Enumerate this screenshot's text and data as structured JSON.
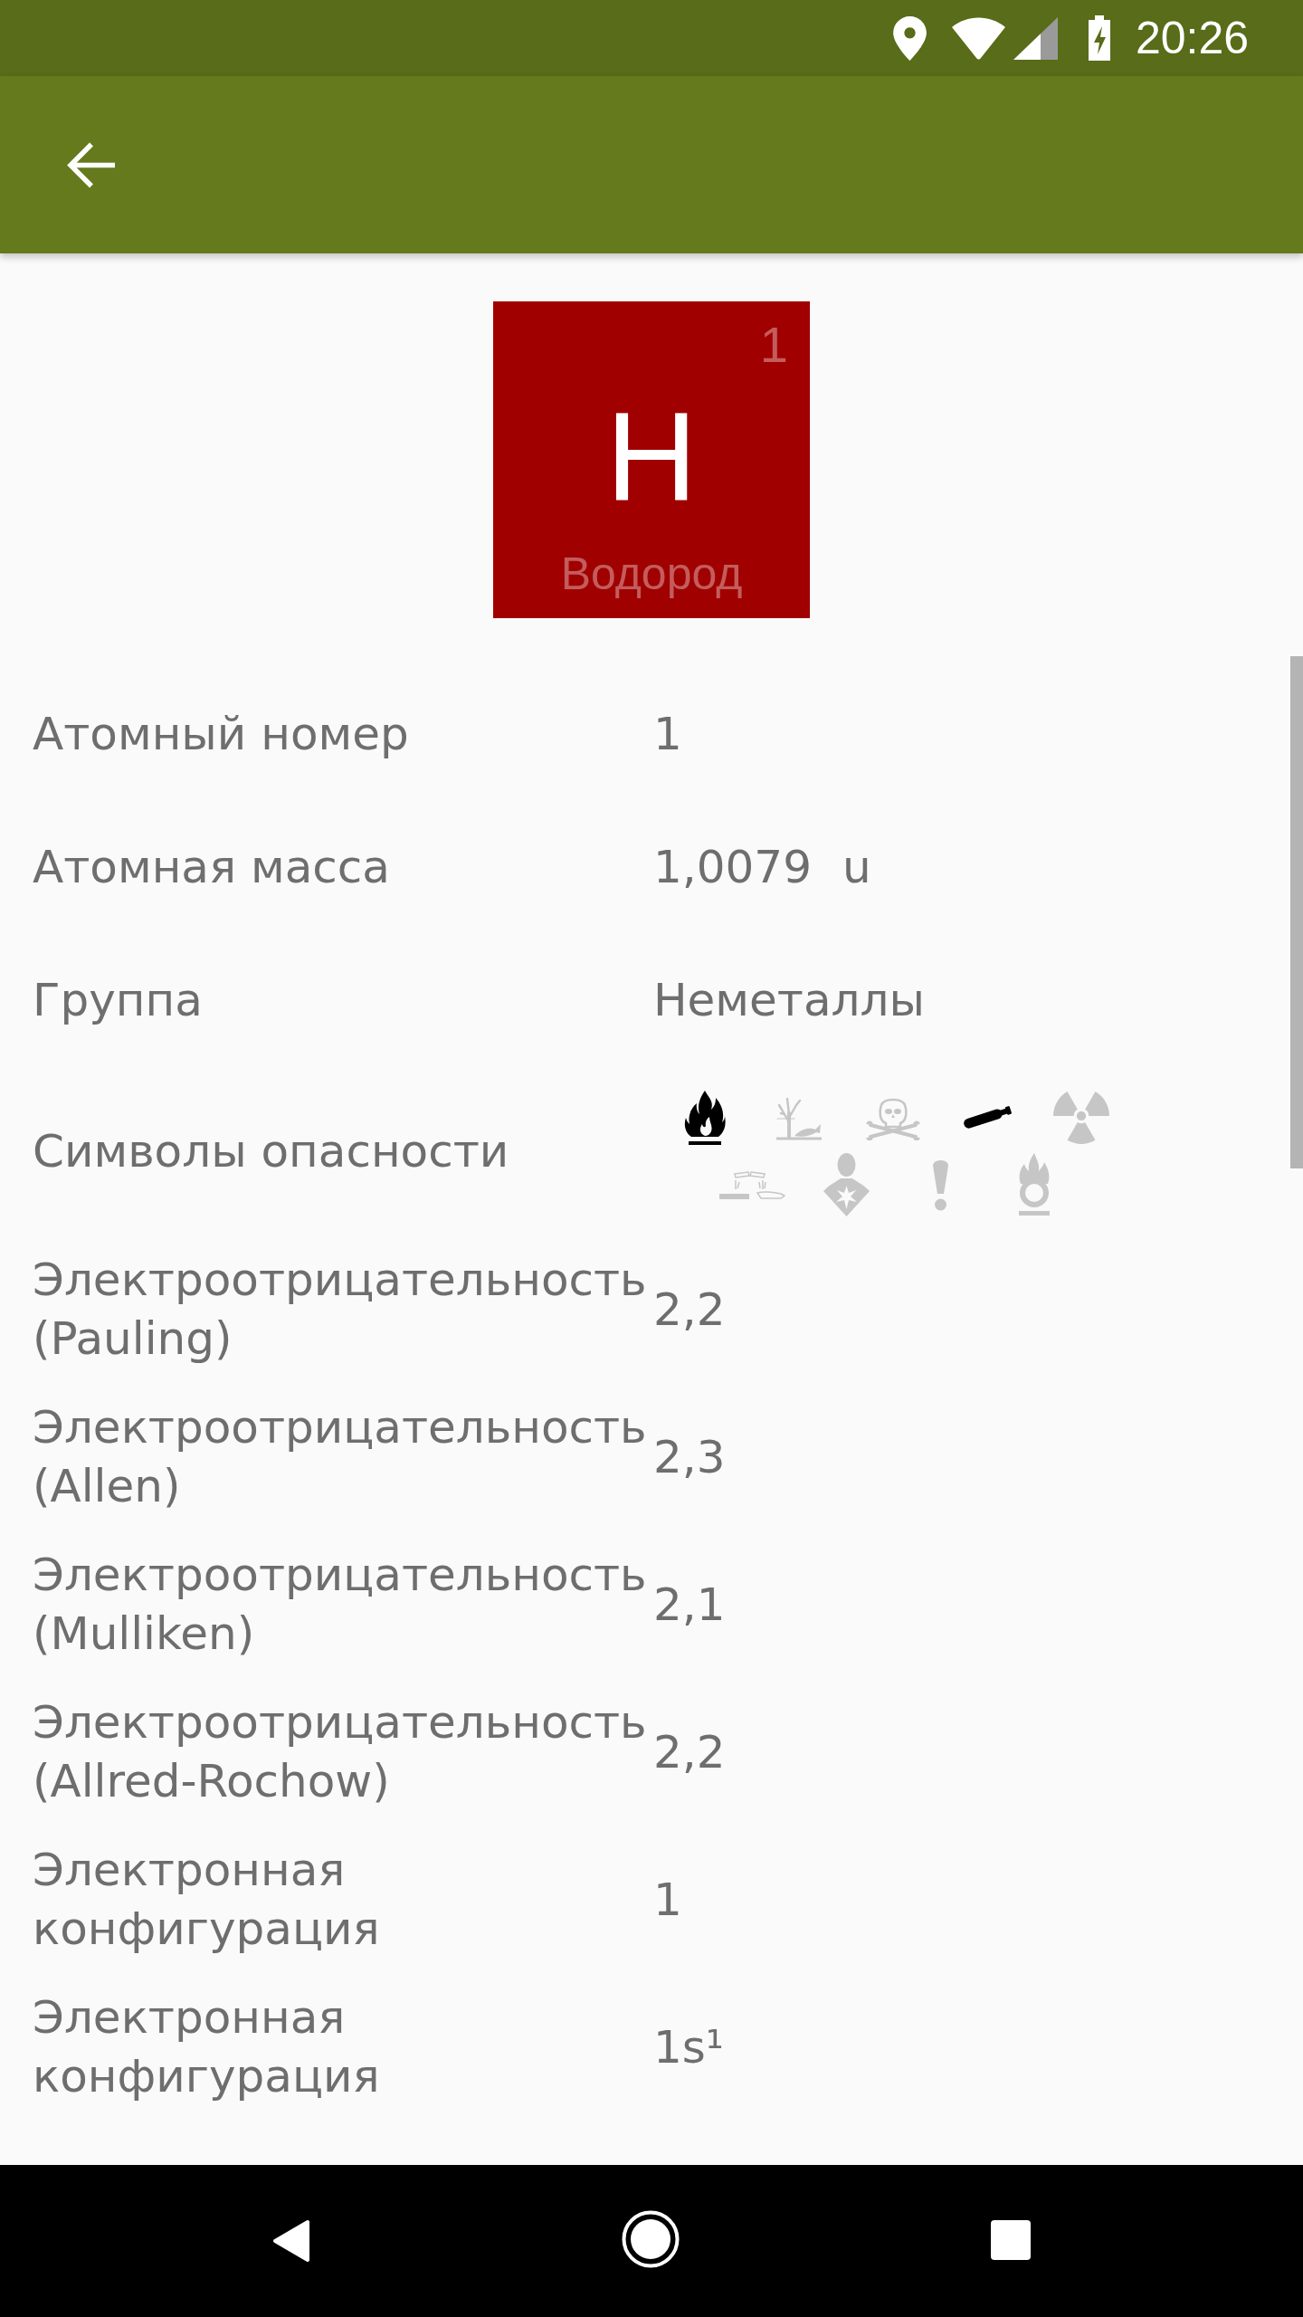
{
  "status_bar": {
    "time": "20:26"
  },
  "element": {
    "number": "1",
    "symbol": "H",
    "name": "Водород"
  },
  "properties": [
    {
      "kind": "text",
      "label": "Атомный номер",
      "value": "1"
    },
    {
      "kind": "text",
      "label": "Атомная масса",
      "value": "1,0079",
      "unit": "u"
    },
    {
      "kind": "text",
      "label": "Группа",
      "value": "Неметаллы"
    },
    {
      "kind": "hazards",
      "label": "Символы опасности",
      "hazards": [
        {
          "kind": "flammable",
          "active": true
        },
        {
          "kind": "environmental",
          "active": false
        },
        {
          "kind": "toxic",
          "active": false
        },
        {
          "kind": "compressed_gas",
          "active": true
        },
        {
          "kind": "radioactive",
          "active": false
        },
        {
          "kind": "corrosive",
          "active": false
        },
        {
          "kind": "health_hazard",
          "active": false
        },
        {
          "kind": "irritant",
          "active": false
        },
        {
          "kind": "oxidizing",
          "active": false
        }
      ]
    },
    {
      "kind": "text",
      "label": "Электроотрицательность (Pauling)",
      "value": "2,2"
    },
    {
      "kind": "text",
      "label": "Электроотрицательность (Allen)",
      "value": "2,3"
    },
    {
      "kind": "text",
      "label": "Электроотрицательность (Mulliken)",
      "value": "2,1"
    },
    {
      "kind": "text",
      "label": "Электроотрицательность (Allred-Rochow)",
      "value": "2,2"
    },
    {
      "kind": "text",
      "label": "Электронная конфигурация",
      "value": "1"
    },
    {
      "kind": "text",
      "label": "Электронная конфигурация",
      "value": "1s¹"
    }
  ]
}
